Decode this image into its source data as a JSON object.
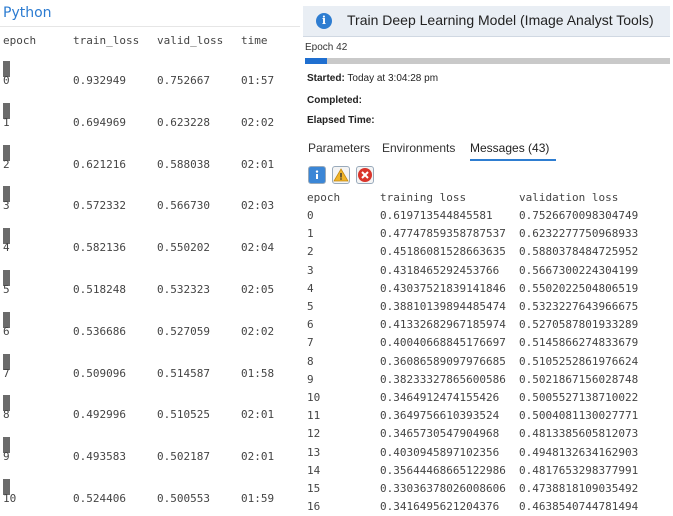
{
  "python": {
    "title": "Python",
    "headers": [
      "epoch",
      "train_loss",
      "valid_loss",
      "time"
    ],
    "rows": [
      [
        "0",
        "0.932949",
        "0.752667",
        "01:57"
      ],
      [
        "1",
        "0.694969",
        "0.623228",
        "02:02"
      ],
      [
        "2",
        "0.621216",
        "0.588038",
        "02:01"
      ],
      [
        "3",
        "0.572332",
        "0.566730",
        "02:03"
      ],
      [
        "4",
        "0.582136",
        "0.550202",
        "02:04"
      ],
      [
        "5",
        "0.518248",
        "0.532323",
        "02:05"
      ],
      [
        "6",
        "0.536686",
        "0.527059",
        "02:02"
      ],
      [
        "7",
        "0.509096",
        "0.514587",
        "01:58"
      ],
      [
        "8",
        "0.492996",
        "0.510525",
        "02:01"
      ],
      [
        "9",
        "0.493583",
        "0.502187",
        "02:01"
      ],
      [
        "10",
        "0.524406",
        "0.500553",
        "01:59"
      ]
    ]
  },
  "gp": {
    "title": "Train Deep Learning Model (Image Analyst Tools)",
    "epoch_status": "Epoch 42",
    "progress_fraction": 0.06,
    "started_label": "Started:",
    "started_value": "Today at 3:04:28 pm",
    "completed_label": "Completed:",
    "elapsed_label": "Elapsed Time:",
    "tabs": [
      "Parameters",
      "Environments",
      "Messages (43)"
    ],
    "active_tab": 2,
    "message_filter_icons": [
      "info-icon",
      "warning-icon",
      "error-icon"
    ],
    "table": {
      "headers": [
        "epoch",
        "training loss",
        "validation loss"
      ],
      "rows": [
        [
          "0",
          "0.619713544845581",
          "0.7526670098304749"
        ],
        [
          "1",
          "0.47747859358787537",
          "0.6232277750968933"
        ],
        [
          "2",
          "0.45186081528663635",
          "0.5880378484725952"
        ],
        [
          "3",
          "0.4318465292453766",
          "0.5667300224304199"
        ],
        [
          "4",
          "0.43037521839141846",
          "0.5502022504806519"
        ],
        [
          "5",
          "0.38810139894485474",
          "0.5323227643966675"
        ],
        [
          "6",
          "0.41332682967185974",
          "0.5270587801933289"
        ],
        [
          "7",
          "0.40040668845176697",
          "0.5145866274833679"
        ],
        [
          "8",
          "0.36086589097976685",
          "0.5105252861976624"
        ],
        [
          "9",
          "0.38233327865600586",
          "0.5021867156028748"
        ],
        [
          "10",
          "0.3464912474155426",
          "0.5005527138710022"
        ],
        [
          "11",
          "0.3649756610393524",
          "0.5004081130027771"
        ],
        [
          "12",
          "0.3465730547904968",
          "0.4813385605812073"
        ],
        [
          "13",
          "0.4030945897102356",
          "0.4948132634162903"
        ],
        [
          "14",
          "0.35644468665122986",
          "0.4817653298377991"
        ],
        [
          "15",
          "0.33036378026008606",
          "0.4738818109035492"
        ],
        [
          "16",
          "0.3416495621204376",
          "0.4638540744781494"
        ]
      ]
    }
  },
  "colors": {
    "accent": "#2e7dd1",
    "progress": "#1f6fd0",
    "header_bg": "#e9eef4"
  }
}
